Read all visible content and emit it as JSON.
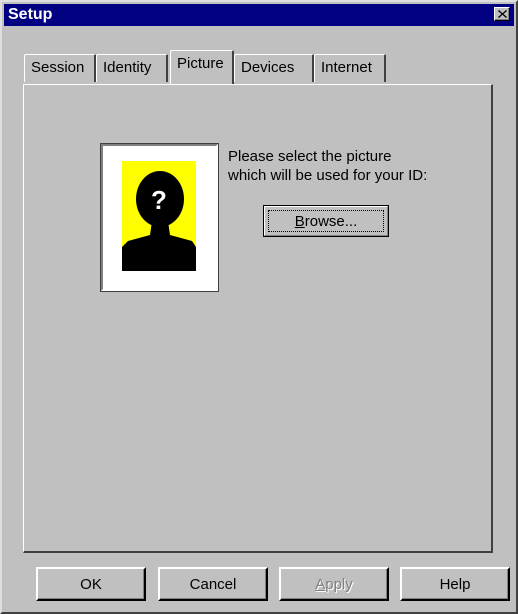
{
  "window": {
    "title": "Setup"
  },
  "tabs": [
    {
      "label": "Session",
      "active": false
    },
    {
      "label": "Identity",
      "active": false
    },
    {
      "label": "Picture",
      "active": true
    },
    {
      "label": "Devices",
      "active": false
    },
    {
      "label": "Internet",
      "active": false
    }
  ],
  "picture": {
    "prompt_line1": "Please select the picture",
    "prompt_line2": "which will be used for your ID:",
    "placeholder_icon": "unknown-person-silhouette-icon",
    "placeholder_symbol": "?",
    "background_color": "#ffff00",
    "browse_label_accel": "B",
    "browse_label_rest": "rowse..."
  },
  "buttons": {
    "ok": "OK",
    "cancel": "Cancel",
    "apply_accel": "A",
    "apply_rest": "pply",
    "apply_enabled": false,
    "help": "Help"
  },
  "colors": {
    "titlebar": "#000080",
    "face": "#c0c0c0"
  }
}
